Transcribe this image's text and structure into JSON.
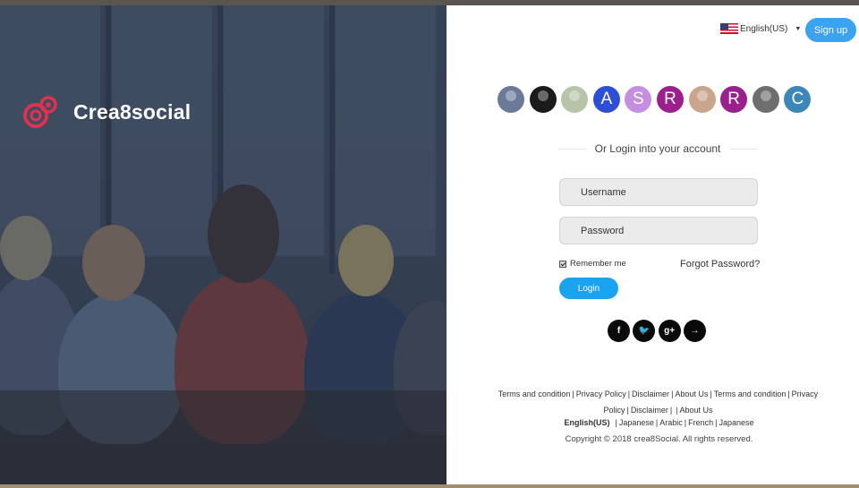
{
  "brand": {
    "name": "Crea8social"
  },
  "header": {
    "language": "English(US)",
    "signup_label": "Sign up"
  },
  "avatars": [
    {
      "type": "photo",
      "color": "#6b7a99"
    },
    {
      "type": "photo",
      "color": "#1b1b1b"
    },
    {
      "type": "photo",
      "color": "#b7c4a8"
    },
    {
      "type": "letter",
      "letter": "A",
      "color": "#2d4fd6"
    },
    {
      "type": "letter",
      "letter": "S",
      "color": "#c58ee0"
    },
    {
      "type": "letter",
      "letter": "R",
      "color": "#9b1f8c"
    },
    {
      "type": "photo",
      "color": "#c9a58c"
    },
    {
      "type": "letter",
      "letter": "R",
      "color": "#9b1f8c"
    },
    {
      "type": "photo",
      "color": "#6e6e6e"
    },
    {
      "type": "letter",
      "letter": "C",
      "color": "#3d87b8"
    }
  ],
  "login": {
    "divider_text": "Or Login into your account",
    "username_placeholder": "Username",
    "password_placeholder": "Password",
    "remember_label": "Remember me",
    "remember_checked": true,
    "forgot_label": "Forgot Password?",
    "submit_label": "Login"
  },
  "socials": [
    {
      "name": "facebook",
      "glyph": "f"
    },
    {
      "name": "twitter",
      "glyph": "🐦"
    },
    {
      "name": "google-plus",
      "glyph": "g+"
    },
    {
      "name": "arrow",
      "glyph": "→"
    }
  ],
  "footer": {
    "links": [
      "Terms and condition",
      "Privacy Policy",
      "Disclaimer",
      "About Us",
      "Terms and condition",
      "Privacy Policy",
      "Disclaimer",
      "About Us"
    ],
    "languages_active": "English(US)",
    "languages": [
      "Japanese",
      "Arabic",
      "French",
      "Japanese"
    ],
    "copyright": "Copyright © 2018 crea8Social. All rights reserved."
  },
  "colors": {
    "accent": "#1aa3f0",
    "signup": "#3ba3ef",
    "hero_overlay": "#3a4658"
  }
}
